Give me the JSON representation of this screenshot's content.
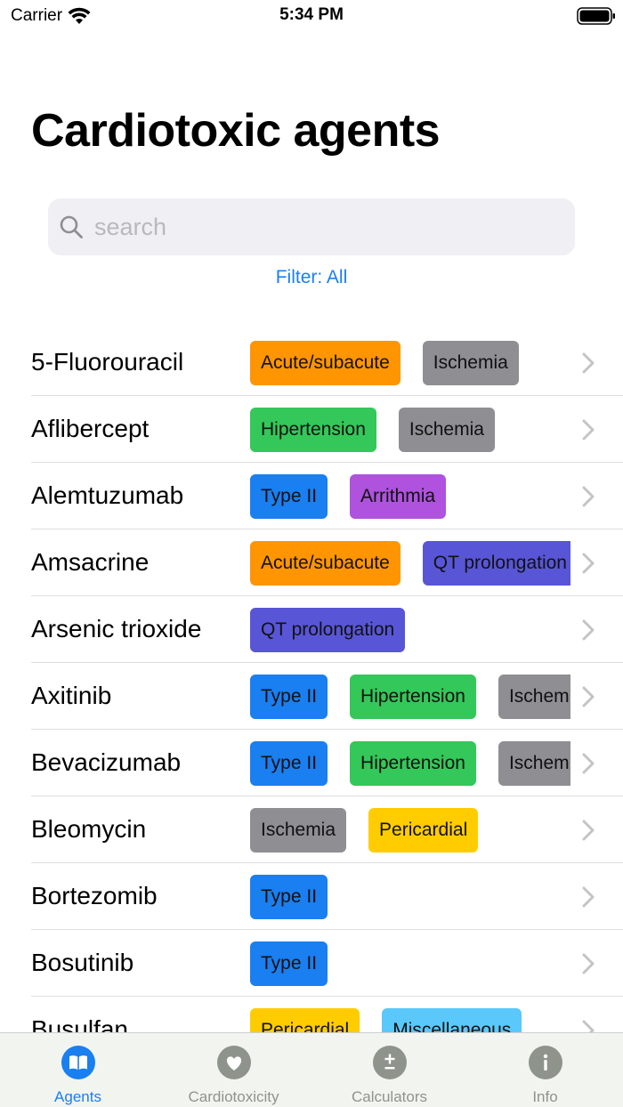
{
  "status_bar": {
    "carrier": "Carrier",
    "time": "5:34 PM"
  },
  "page": {
    "title": "Cardiotoxic agents"
  },
  "search": {
    "placeholder": "search",
    "value": ""
  },
  "filter": {
    "label": "Filter: All"
  },
  "tag_colors": {
    "Acute/subacute": "#ff9500",
    "Ischemia": "#8e8e93",
    "Hipertension": "#34c759",
    "Type II": "#1a7ff0",
    "Arrithmia": "#af52de",
    "QT prolongation": "#5856d6",
    "Pericardial": "#ffcc00",
    "Miscellaneous": "#5ac8fa"
  },
  "agents": [
    {
      "name": "5-Fluorouracil",
      "tags": [
        "Acute/subacute",
        "Ischemia"
      ]
    },
    {
      "name": "Aflibercept",
      "tags": [
        "Hipertension",
        "Ischemia"
      ]
    },
    {
      "name": "Alemtuzumab",
      "tags": [
        "Type II",
        "Arrithmia"
      ]
    },
    {
      "name": "Amsacrine",
      "tags": [
        "Acute/subacute",
        "QT prolongation"
      ]
    },
    {
      "name": "Arsenic trioxide",
      "tags": [
        "QT prolongation"
      ]
    },
    {
      "name": "Axitinib",
      "tags": [
        "Type II",
        "Hipertension",
        "Ischemia"
      ]
    },
    {
      "name": "Bevacizumab",
      "tags": [
        "Type II",
        "Hipertension",
        "Ischemia"
      ]
    },
    {
      "name": "Bleomycin",
      "tags": [
        "Ischemia",
        "Pericardial"
      ]
    },
    {
      "name": "Bortezomib",
      "tags": [
        "Type II"
      ]
    },
    {
      "name": "Bosutinib",
      "tags": [
        "Type II"
      ]
    },
    {
      "name": "Busulfan",
      "tags": [
        "Pericardial",
        "Miscellaneous"
      ]
    }
  ],
  "tabs": [
    {
      "label": "Agents",
      "icon": "book-icon",
      "active": true
    },
    {
      "label": "Cardiotoxicity",
      "icon": "heart-icon",
      "active": false
    },
    {
      "label": "Calculators",
      "icon": "plus-minus-icon",
      "active": false
    },
    {
      "label": "Info",
      "icon": "info-icon",
      "active": false
    }
  ]
}
